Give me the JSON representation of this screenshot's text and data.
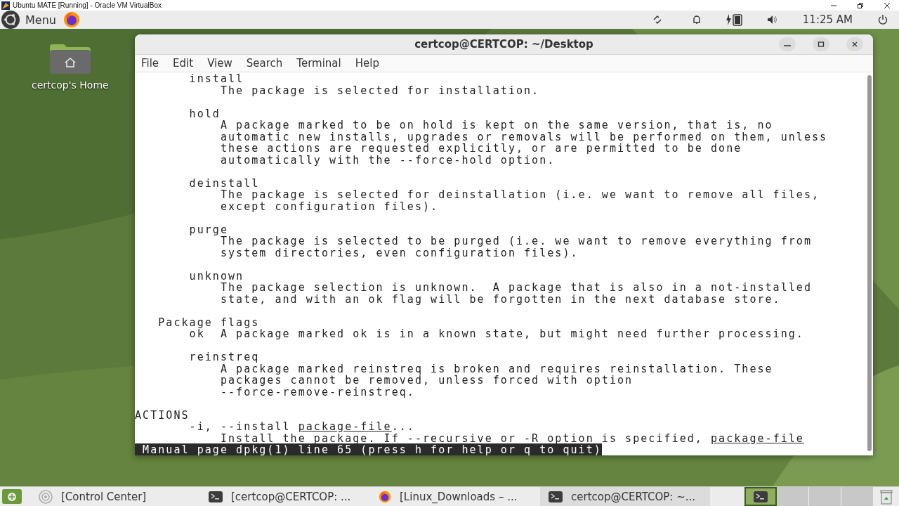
{
  "host_window": {
    "title": "Ubuntu MATE [Running] - Oracle VM VirtualBox"
  },
  "panel": {
    "menu_label": "Menu",
    "clock": "11:25 AM"
  },
  "desktop_icons": [
    {
      "label": "certcop's Home"
    }
  ],
  "terminal": {
    "title": "certcop@CERTCOP: ~/Desktop",
    "menu": [
      "File",
      "Edit",
      "View",
      "Search",
      "Terminal",
      "Help"
    ],
    "paragraphs": [
      {
        "lines": [
          {
            "text": "       install"
          },
          {
            "text": "           The package is selected for installation."
          }
        ]
      },
      {
        "lines": [
          {
            "text": "       hold"
          },
          {
            "text": "           A package marked to be on hold is kept on the same version, that is, no"
          },
          {
            "text": "           automatic new installs, upgrades or removals will be performed on them, unless"
          },
          {
            "text": "           these actions are requested explicitly, or are permitted to be done"
          },
          {
            "text": "           automatically with the --force-hold option."
          }
        ]
      },
      {
        "lines": [
          {
            "text": "       deinstall"
          },
          {
            "text": "           The package is selected for deinstallation (i.e. we want to remove all files,"
          },
          {
            "text": "           except configuration files)."
          }
        ]
      },
      {
        "lines": [
          {
            "text": "       purge"
          },
          {
            "text": "           The package is selected to be purged (i.e. we want to remove everything from"
          },
          {
            "text": "           system directories, even configuration files)."
          }
        ]
      },
      {
        "lines": [
          {
            "text": "       unknown"
          },
          {
            "text": "           The package selection is unknown.  A package that is also in a not-installed"
          },
          {
            "text": "           state, and with an ok flag will be forgotten in the next database store."
          }
        ]
      },
      {
        "lines": [
          {
            "text": "   Package flags"
          },
          {
            "text": "       ok  A package marked ok is in a known state, but might need further processing."
          }
        ]
      },
      {
        "lines": [
          {
            "text": "       reinstreq"
          },
          {
            "text": "           A package marked reinstreq is broken and requires reinstallation. These"
          },
          {
            "text": "           packages cannot be removed, unless forced with option"
          },
          {
            "text": "           --force-remove-reinstreq."
          }
        ]
      },
      {
        "lines": [
          {
            "text": "ACTIONS"
          },
          {
            "parts": [
              {
                "text": "       -i, --install ",
                "underline": false
              },
              {
                "text": "package-file",
                "underline": true
              },
              {
                "text": "...",
                "underline": false
              }
            ]
          },
          {
            "parts": [
              {
                "text": "           Install the package. If --recursive or -R option is specified, ",
                "underline": false
              },
              {
                "text": "package-file",
                "underline": true
              }
            ]
          }
        ]
      }
    ],
    "status_line": " Manual page dpkg(1) line 65 (press h for help or q to quit)"
  },
  "taskbar": {
    "items": [
      {
        "kind": "control-center",
        "label": "[Control Center]",
        "selected": false
      },
      {
        "kind": "terminal",
        "label": "[certcop@CERTCOP: ...",
        "selected": false
      },
      {
        "kind": "firefox",
        "label": "[Linux_Downloads – ...",
        "selected": false
      },
      {
        "kind": "terminal",
        "label": "certcop@CERTCOP: ~...",
        "selected": true
      }
    ],
    "workspaces": [
      {
        "selected": true
      },
      {
        "selected": false
      },
      {
        "selected": false
      },
      {
        "selected": false
      }
    ]
  }
}
